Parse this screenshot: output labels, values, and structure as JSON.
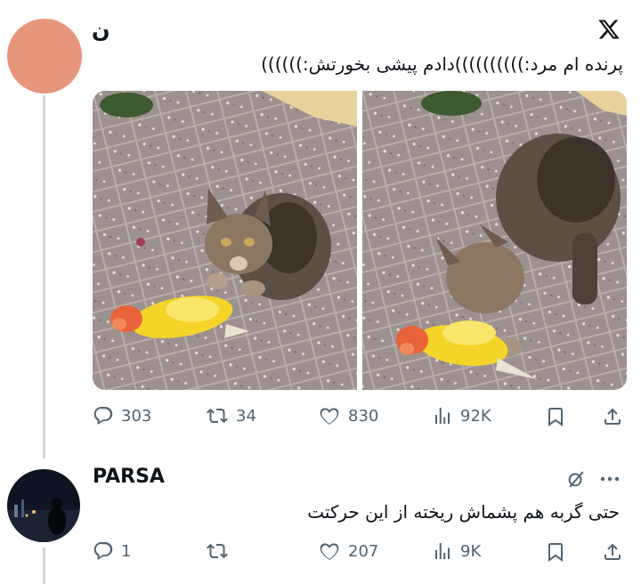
{
  "main_tweet": {
    "author_name": "ن",
    "text": "پرنده ام مرد:))))))))))دادم پیشی بخورتش:))))))",
    "actions": {
      "replies": "303",
      "reposts": "34",
      "likes": "830",
      "views": "92K"
    }
  },
  "reply_tweet": {
    "author_name": "PARSA",
    "text": "حتی گربه هم پشماش ریخته از این حرکتت",
    "actions": {
      "replies": "1",
      "reposts": "",
      "likes": "207",
      "views": "9K"
    }
  },
  "icons": [
    "x-logo-icon",
    "reply-icon",
    "repost-icon",
    "like-icon",
    "views-icon",
    "bookmark-icon",
    "share-icon",
    "grok-icon",
    "more-icon"
  ],
  "colors": {
    "accent_avatar": "#e8957d",
    "muted": "#536471",
    "line": "#cfd9de"
  }
}
